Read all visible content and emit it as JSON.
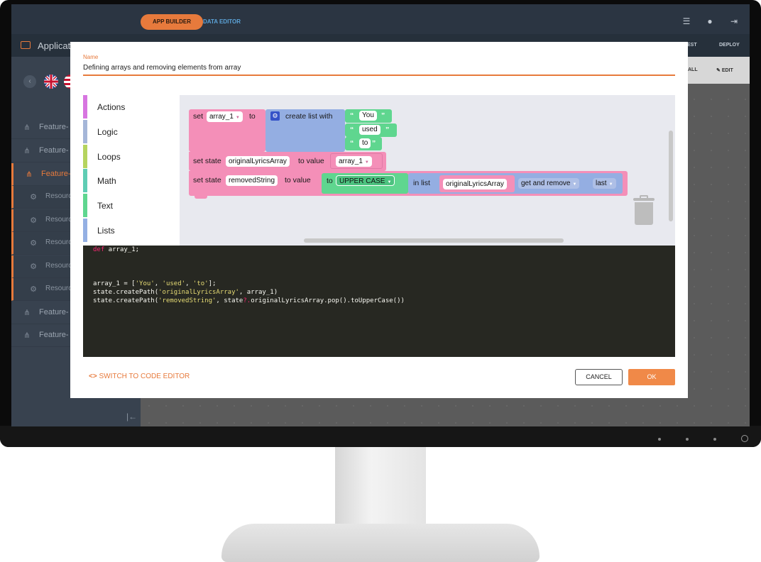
{
  "topbar": {
    "tab_app_builder": "APP BUILDER",
    "tab_data_editor": "DATA EDITOR",
    "icons": [
      "sliders-icon",
      "user-icon",
      "logout-icon"
    ]
  },
  "subbar": {
    "app_title": "Applicatio",
    "right_items": [
      "EST",
      "DEPLOY"
    ]
  },
  "sidebar": {
    "items": [
      {
        "label": "Feature-",
        "icon": "hierarchy-icon",
        "active": false
      },
      {
        "label": "Feature-",
        "icon": "hierarchy-icon",
        "active": false
      },
      {
        "label": "Feature-C",
        "icon": "hierarchy-icon",
        "active": true
      },
      {
        "label": "Resourc",
        "icon": "gear-icon",
        "sub": true
      },
      {
        "label": "Resourc",
        "icon": "gear-icon",
        "sub": true
      },
      {
        "label": "Resourc",
        "icon": "gear-icon",
        "sub": true
      },
      {
        "label": "Resourc",
        "icon": "gear-icon",
        "sub": true
      },
      {
        "label": "Resourc",
        "icon": "gear-icon",
        "sub": true
      },
      {
        "label": "Feature-",
        "icon": "hierarchy-icon",
        "active": false
      },
      {
        "label": "Feature-",
        "icon": "hierarchy-icon",
        "active": false
      }
    ]
  },
  "toolbar_right": {
    "all_label": "ALL",
    "edit_label": "EDIT"
  },
  "modal": {
    "name_label": "Name",
    "name_value": "Defining arrays and removing elements from array",
    "categories": [
      {
        "label": "Actions",
        "color": "#d775e0"
      },
      {
        "label": "Logic",
        "color": "#a5b6d8"
      },
      {
        "label": "Loops",
        "color": "#b5d45f"
      },
      {
        "label": "Math",
        "color": "#5fcdb4"
      },
      {
        "label": "Text",
        "color": "#5fd68f"
      },
      {
        "label": "Lists",
        "color": "#94b0e3"
      }
    ],
    "blocks": {
      "set": "set",
      "var": "array_1",
      "to": "to",
      "create_list": "create list with",
      "list_items": [
        "You",
        "used",
        "to"
      ],
      "set_state": "set state",
      "state_1": "originalLyricsArray",
      "to_value": "to value",
      "array_ref": "array_1",
      "state_2": "removedString",
      "to_case": "to",
      "case_value": "UPPER CASE",
      "in_list": "in list",
      "list_ref": "originalLyricsArray",
      "op": "get and remove",
      "pos": "last"
    },
    "code": {
      "line1_kw": "def",
      "line1_rest": " array_1;",
      "line2": "array_1 = [",
      "line2_s1": "'You'",
      "line2_s2": "'used'",
      "line2_s3": "'to'",
      "line2_end": "];",
      "line3_a": "state.createPath(",
      "line3_s": "'originalLyricsArray'",
      "line3_b": ", array_1)",
      "line4_a": "state.createPath(",
      "line4_s": "'removedString'",
      "line4_b": ", state",
      "line4_q": "?.",
      "line4_c": "originalLyricsArray.pop().toUpperCase())"
    },
    "switch_editor": "SWITCH TO CODE EDITOR",
    "cancel": "CANCEL",
    "ok": "OK"
  },
  "colors": {
    "accent": "#e77a3c",
    "block_pink": "#f48fb8",
    "block_blue": "#94aee2",
    "block_green": "#5fd68f",
    "code_bg": "#272822"
  }
}
